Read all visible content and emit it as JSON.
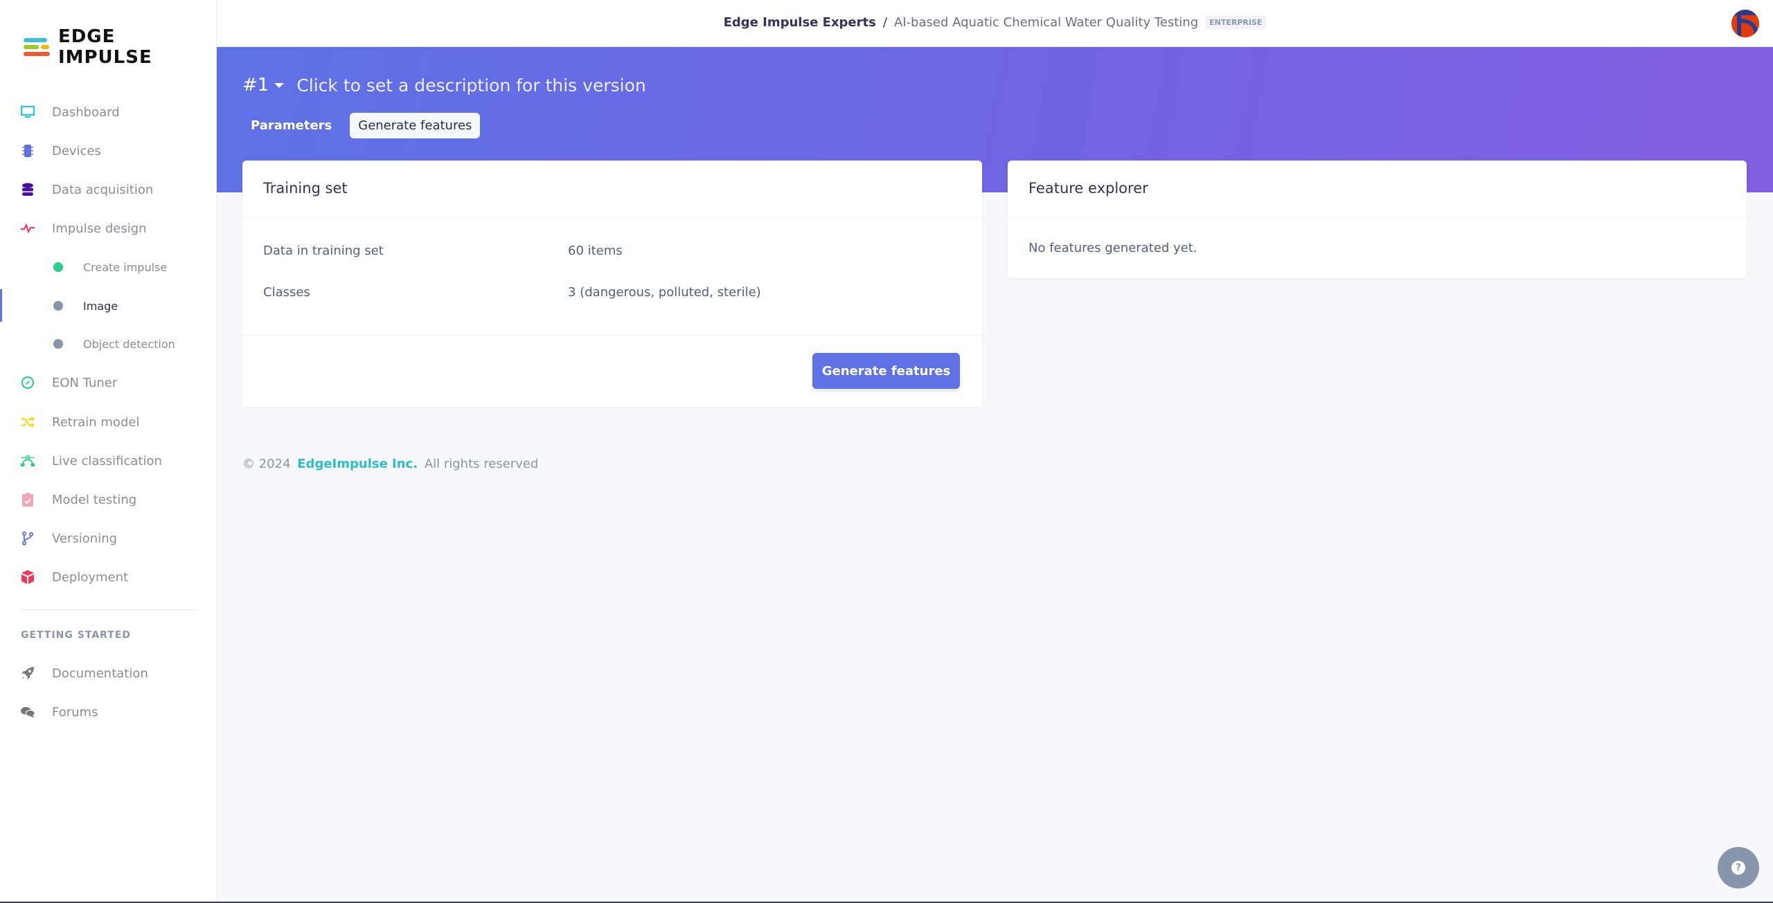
{
  "app": {
    "logo_text": "EDGE IMPULSE"
  },
  "header": {
    "org": "Edge Impulse Experts",
    "separator": "/",
    "project": "AI-based Aquatic Chemical Water Quality Testing",
    "badge": "ENTERPRISE"
  },
  "sidebar": {
    "items": [
      {
        "label": "Dashboard",
        "icon": "monitor-icon",
        "color": "#11cdef"
      },
      {
        "label": "Devices",
        "icon": "chip-icon",
        "color": "#5e72e4"
      },
      {
        "label": "Data acquisition",
        "icon": "database-icon",
        "color": "#4a0fa3"
      },
      {
        "label": "Impulse design",
        "icon": "pulse-icon",
        "color": "#f5365c"
      },
      {
        "label": "EON Tuner",
        "icon": "compass-icon",
        "color": "#2dce89"
      },
      {
        "label": "Retrain model",
        "icon": "shuffle-icon",
        "color": "#ffd600"
      },
      {
        "label": "Live classification",
        "icon": "bezier-icon",
        "color": "#2dce89"
      },
      {
        "label": "Model testing",
        "icon": "clipboard-check-icon",
        "color": "#f3a4b5"
      },
      {
        "label": "Versioning",
        "icon": "git-branch-icon",
        "color": "#5e72e4"
      },
      {
        "label": "Deployment",
        "icon": "cube-icon",
        "color": "#f5365c"
      }
    ],
    "subitems": [
      {
        "label": "Create impulse",
        "status_color": "#2dce89"
      },
      {
        "label": "Image",
        "status_color": "#8796ab",
        "active": true
      },
      {
        "label": "Object detection",
        "status_color": "#8796ab"
      }
    ],
    "section_title": "GETTING STARTED",
    "getting_started": [
      {
        "label": "Documentation",
        "icon": "rocket-icon"
      },
      {
        "label": "Forums",
        "icon": "comments-icon"
      }
    ]
  },
  "version": {
    "number": "#1",
    "description_placeholder": "Click to set a description for this version"
  },
  "tabs": [
    {
      "label": "Parameters",
      "active": false
    },
    {
      "label": "Generate features",
      "active": true
    }
  ],
  "training_set": {
    "title": "Training set",
    "rows": [
      {
        "label": "Data in training set",
        "value": "60 items"
      },
      {
        "label": "Classes",
        "value": "3 (dangerous, polluted, sterile)"
      }
    ],
    "button": "Generate features"
  },
  "feature_explorer": {
    "title": "Feature explorer",
    "empty_message": "No features generated yet."
  },
  "footer": {
    "copyright": "© 2024",
    "company": "EdgeImpulse Inc.",
    "rights": "All rights reserved"
  },
  "help": {
    "icon": "question-icon"
  },
  "colors": {
    "accent": "#5e72e4",
    "band_end": "#825ee0",
    "link": "#2bbec9"
  }
}
